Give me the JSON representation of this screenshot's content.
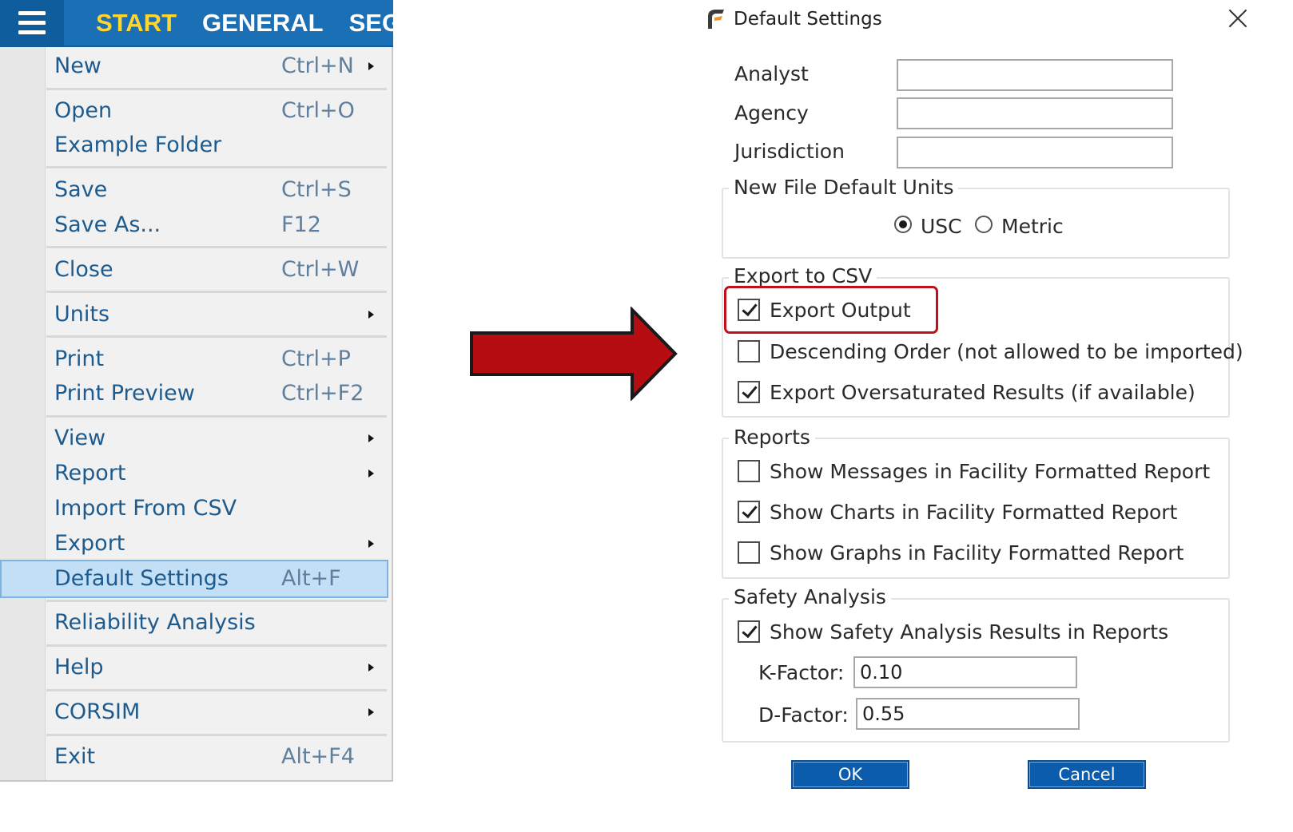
{
  "ribbon": {
    "tabs": [
      "START",
      "GENERAL",
      "SEG"
    ]
  },
  "menu": {
    "items": [
      {
        "label": "New",
        "shortcut": "Ctrl+N",
        "submenu": true
      },
      {
        "label": "Open",
        "shortcut": "Ctrl+O",
        "submenu": false
      },
      {
        "label": "Example Folder",
        "shortcut": "",
        "submenu": false
      },
      {
        "label": "Save",
        "shortcut": "Ctrl+S",
        "submenu": false
      },
      {
        "label": "Save As...",
        "shortcut": "F12",
        "submenu": false
      },
      {
        "label": "Close",
        "shortcut": "Ctrl+W",
        "submenu": false
      },
      {
        "label": "Units",
        "shortcut": "",
        "submenu": true
      },
      {
        "label": "Print",
        "shortcut": "Ctrl+P",
        "submenu": false
      },
      {
        "label": "Print Preview",
        "shortcut": "Ctrl+F2",
        "submenu": false
      },
      {
        "label": "View",
        "shortcut": "",
        "submenu": true
      },
      {
        "label": "Report",
        "shortcut": "",
        "submenu": true
      },
      {
        "label": "Import From CSV",
        "shortcut": "",
        "submenu": false
      },
      {
        "label": "Export",
        "shortcut": "",
        "submenu": true
      },
      {
        "label": "Default Settings",
        "shortcut": "Alt+F",
        "submenu": false,
        "highlighted": true
      },
      {
        "label": "Reliability Analysis",
        "shortcut": "",
        "submenu": false
      },
      {
        "label": "Help",
        "shortcut": "",
        "submenu": true
      },
      {
        "label": "CORSIM",
        "shortcut": "",
        "submenu": true
      },
      {
        "label": "Exit",
        "shortcut": "Alt+F4",
        "submenu": false
      }
    ]
  },
  "dialog": {
    "title": "Default Settings",
    "analyst": {
      "label": "Analyst",
      "value": ""
    },
    "agency": {
      "label": "Agency",
      "value": ""
    },
    "jurisdiction": {
      "label": "Jurisdiction",
      "value": ""
    },
    "units_group": {
      "title": "New File Default Units",
      "options": [
        {
          "label": "USC",
          "selected": true
        },
        {
          "label": "Metric",
          "selected": false
        }
      ]
    },
    "csv_group": {
      "title": "Export to CSV",
      "checks": [
        {
          "label": "Export Output",
          "checked": true
        },
        {
          "label": "Descending Order (not allowed to be imported)",
          "checked": false
        },
        {
          "label": "Export Oversaturated Results (if available)",
          "checked": true
        }
      ]
    },
    "reports_group": {
      "title": "Reports",
      "checks": [
        {
          "label": "Show Messages in Facility Formatted Report",
          "checked": false
        },
        {
          "label": "Show Charts in Facility Formatted Report",
          "checked": true
        },
        {
          "label": "Show Graphs in Facility Formatted Report",
          "checked": false
        }
      ]
    },
    "safety_group": {
      "title": "Safety Analysis",
      "checks": [
        {
          "label": "Show Safety Analysis Results in Reports",
          "checked": true
        }
      ],
      "k_factor": {
        "label": "K-Factor:",
        "value": "0.10"
      },
      "d_factor": {
        "label": "D-Factor:",
        "value": "0.55"
      }
    },
    "ok_label": "OK",
    "cancel_label": "Cancel"
  },
  "colors": {
    "ribbon_blue": "#1b6fb5",
    "active_tab": "#ffd52e",
    "menu_text": "#1d5b8e",
    "highlight_fill": "#c3dff6",
    "arrow_red": "#b50d12",
    "callout_red": "#c0111a",
    "button_blue": "#0b5cad"
  }
}
